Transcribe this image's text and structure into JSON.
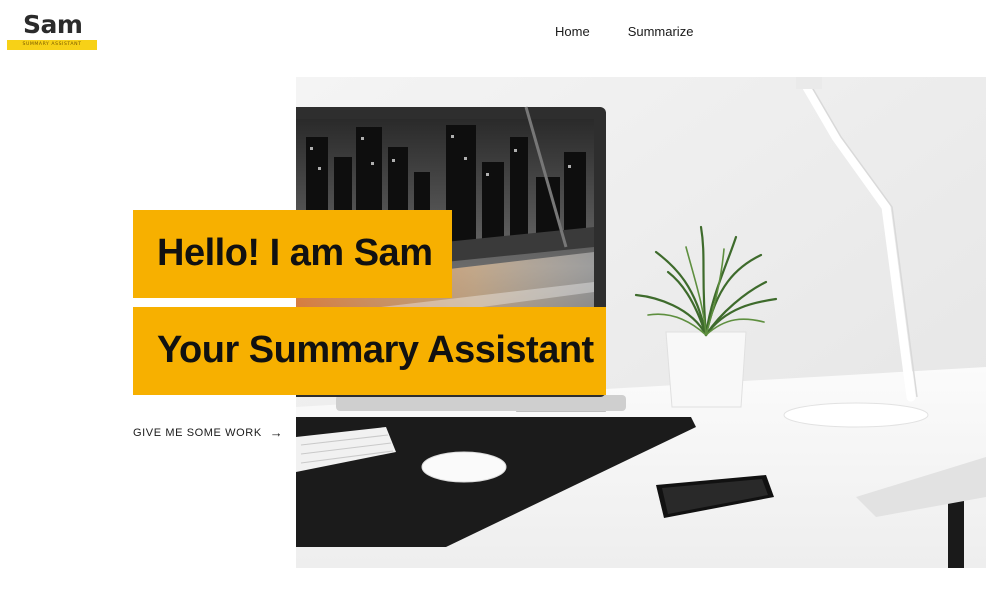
{
  "brand": {
    "name": "Sam",
    "tagline": "SUMMARY ASSISTANT",
    "band_color": "#f7d117"
  },
  "nav": {
    "items": [
      {
        "label": "Home"
      },
      {
        "label": "Summarize"
      }
    ]
  },
  "hero": {
    "headline_line1": "Hello! I am Sam",
    "headline_line2": "Your Summary Assistant",
    "accent_color": "#f7b000",
    "cta_label": "GIVE ME SOME WORK",
    "cta_icon": "arrow-right-icon",
    "image_subject": "desk-workspace-photo"
  }
}
